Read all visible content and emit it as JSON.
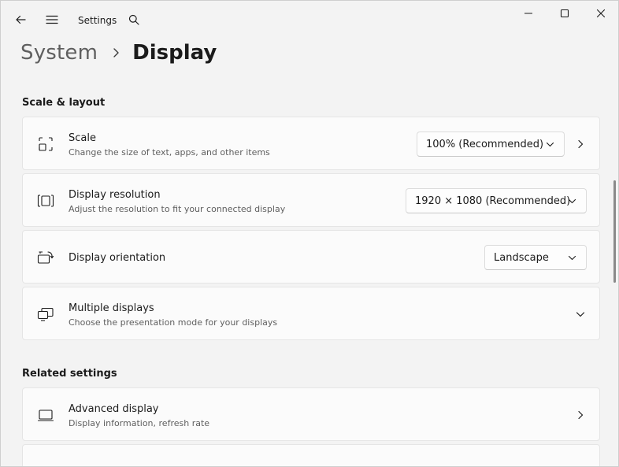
{
  "app": {
    "title": "Settings"
  },
  "breadcrumb": {
    "parent": "System",
    "current": "Display"
  },
  "sections": {
    "scale_layout": "Scale & layout",
    "related": "Related settings"
  },
  "scale": {
    "title": "Scale",
    "desc": "Change the size of text, apps, and other items",
    "value": "100% (Recommended)"
  },
  "resolution": {
    "title": "Display resolution",
    "desc": "Adjust the resolution to fit your connected display",
    "value": "1920 × 1080 (Recommended)"
  },
  "orientation": {
    "title": "Display orientation",
    "value": "Landscape"
  },
  "multiple": {
    "title": "Multiple displays",
    "desc": "Choose the presentation mode for your displays"
  },
  "advanced": {
    "title": "Advanced display",
    "desc": "Display information, refresh rate"
  },
  "icons": {
    "back": "back-arrow-icon",
    "menu": "hamburger-menu-icon",
    "search": "search-icon",
    "minimize": "minimize-icon",
    "maximize": "maximize-icon",
    "close": "close-icon"
  },
  "colors": {
    "background": "#f3f3f3",
    "card": "#fbfbfb",
    "accent_text": "#1b1b1b",
    "secondary_text": "#5f5f5f"
  }
}
